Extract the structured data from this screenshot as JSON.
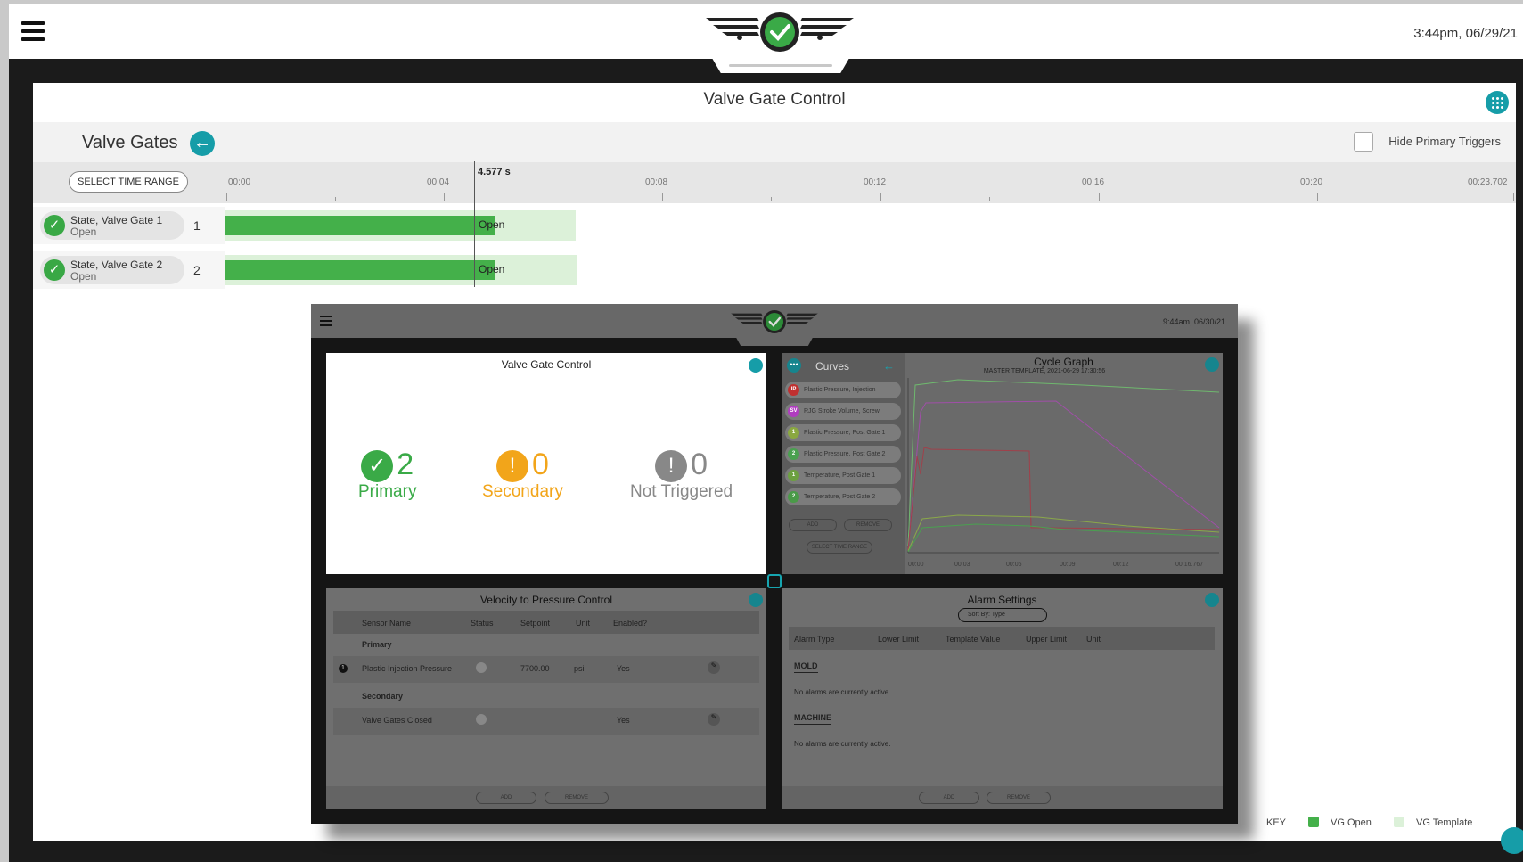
{
  "app": {
    "clock": "3:44pm, 06/29/21"
  },
  "panel": {
    "title": "Valve Gate Control",
    "section_title": "Valve Gates",
    "hide_primary_label": "Hide Primary Triggers",
    "select_time_range": "SELECT TIME RANGE",
    "cursor_time": "4.577 s",
    "ticks": [
      "00:00",
      "00:04",
      "00:08",
      "00:12",
      "00:16",
      "00:20",
      "00:23.702"
    ],
    "gates": [
      {
        "name": "State, Valve Gate 1",
        "state": "Open",
        "number": "1",
        "bar_label": "Open"
      },
      {
        "name": "State, Valve Gate 2",
        "state": "Open",
        "number": "2",
        "bar_label": "Open"
      }
    ],
    "key": {
      "title": "KEY",
      "open": "VG Open",
      "template": "VG Template",
      "open_color": "#44b04a",
      "template_color": "#dcf1d9"
    }
  },
  "embedded": {
    "clock": "9:44am, 06/30/21",
    "vgc": {
      "title": "Valve Gate Control",
      "primary_count": "2",
      "primary_label": "Primary",
      "secondary_count": "0",
      "secondary_label": "Secondary",
      "not_triggered_count": "0",
      "not_triggered_label": "Not Triggered"
    },
    "curves": {
      "title": "Curves",
      "items": [
        {
          "badge": "IP",
          "label": "Plastic Pressure, Injection",
          "color": "#c03030"
        },
        {
          "badge": "SV",
          "label": "RJG Stroke Volume, Screw",
          "color": "#b03cc0"
        },
        {
          "badge": "1",
          "label": "Plastic Pressure, Post Gate 1",
          "color": "#8aa840"
        },
        {
          "badge": "2",
          "label": "Plastic Pressure, Post Gate 2",
          "color": "#4aa050"
        },
        {
          "badge": "1",
          "label": "Temperature, Post Gate 1",
          "color": "#6ca040"
        },
        {
          "badge": "2",
          "label": "Temperature, Post Gate 2",
          "color": "#4a9a48"
        }
      ],
      "add": "ADD",
      "remove": "REMOVE",
      "select_time_range": "SELECT TIME RANGE"
    },
    "cycle_graph": {
      "title": "Cycle Graph",
      "subtitle": "MASTER TEMPLATE, 2021-06-29 17:30:56",
      "ticks": [
        "00:00",
        "00:03",
        "00:06",
        "00:09",
        "00:12",
        "00:16.767"
      ]
    },
    "vpc": {
      "title": "Velocity to Pressure Control",
      "headers": [
        "Sensor Name",
        "Status",
        "Setpoint",
        "Unit",
        "Enabled?"
      ],
      "primary": "Primary",
      "secondary": "Secondary",
      "row1": {
        "name": "Plastic Injection Pressure",
        "setpoint": "7700.00",
        "unit": "psi",
        "enabled": "Yes"
      },
      "row2": {
        "name": "Valve Gates Closed",
        "enabled": "Yes"
      },
      "add": "ADD",
      "remove": "REMOVE"
    },
    "alarms": {
      "title": "Alarm Settings",
      "sort": "Sort By:  Type",
      "headers": [
        "Alarm Type",
        "Lower Limit",
        "Template Value",
        "Upper Limit",
        "Unit"
      ],
      "mold": "MOLD",
      "mold_msg": "No alarms are currently active.",
      "machine": "MACHINE",
      "machine_msg": "No alarms are currently active.",
      "add": "ADD",
      "remove": "REMOVE"
    }
  }
}
